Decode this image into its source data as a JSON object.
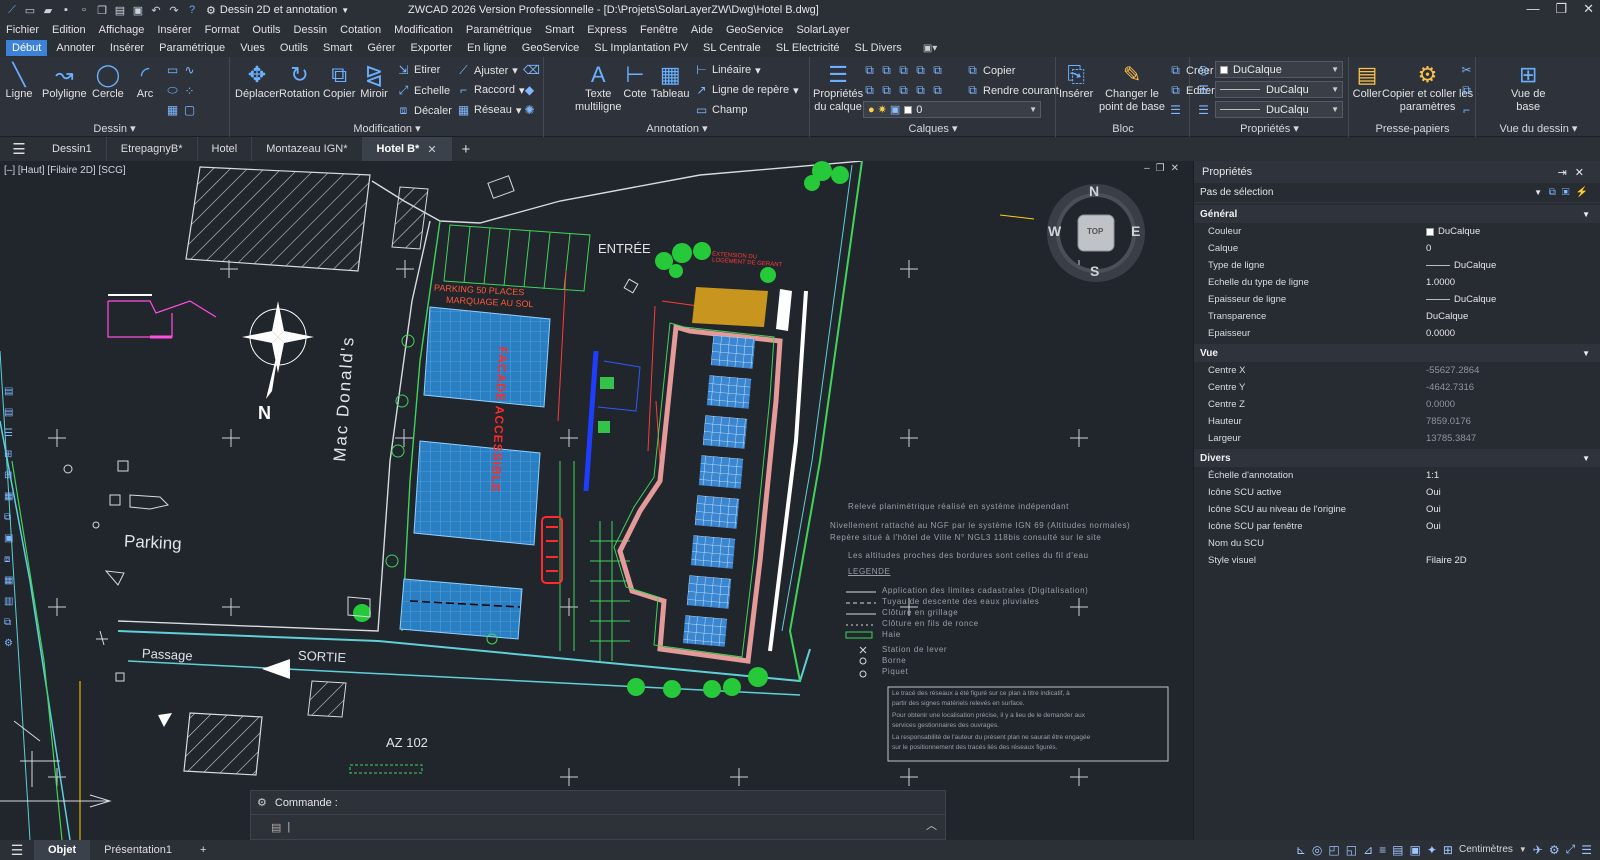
{
  "titlebar": {
    "workspace": "Dessin 2D et annotation",
    "title": "ZWCAD 2026 Version Professionnelle - [D:\\Projets\\SolarLayerZW\\Dwg\\Hotel B.dwg]"
  },
  "menu": [
    "Fichier",
    "Edition",
    "Affichage",
    "Insérer",
    "Format",
    "Outils",
    "Dessin",
    "Cotation",
    "Modification",
    "Paramétrique",
    "Smart",
    "Express",
    "Fenêtre",
    "Aide",
    "GeoService",
    "SolarLayer"
  ],
  "ribbon_tabs": [
    "Début",
    "Annoter",
    "Insérer",
    "Paramétrique",
    "Vues",
    "Outils",
    "Smart",
    "Gérer",
    "Exporter",
    "En ligne",
    "GeoService",
    "SL Implantation PV",
    "SL Centrale",
    "SL Electricité",
    "SL Divers"
  ],
  "ribbon": {
    "dessin": {
      "label": "Dessin",
      "ligne": "Ligne",
      "polyligne": "Polyligne",
      "cercle": "Cercle",
      "arc": "Arc"
    },
    "modification": {
      "label": "Modification",
      "deplacer": "Déplacer",
      "rotation": "Rotation",
      "copier": "Copier",
      "miroir": "Miroir",
      "etirer": "Etirer",
      "echelle": "Echelle",
      "decaler": "Décaler",
      "ajuster": "Ajuster",
      "raccord": "Raccord",
      "reseau": "Réseau"
    },
    "annotation": {
      "label": "Annotation",
      "texte1": "Texte",
      "texte2": "multiligne",
      "cote": "Cote",
      "tableau": "Tableau",
      "lineaire": "Linéaire",
      "ligne_repere": "Ligne de repère",
      "champ": "Champ"
    },
    "calques": {
      "label": "Calques",
      "prop1": "Propriétés",
      "prop2": "du calque",
      "copier": "Copier",
      "rendre_courant": "Rendre courant",
      "layer": "0"
    },
    "bloc": {
      "label": "Bloc",
      "inserer": "Insérer",
      "changer1": "Changer le",
      "changer2": "point de base",
      "creer": "Créer",
      "editer": "Editer"
    },
    "proprietes": {
      "label": "Propriétés",
      "couleur": "DuCalque",
      "type": "DuCalqu",
      "epaisseur": "DuCalqu"
    },
    "presse": {
      "label": "Presse-papiers",
      "coller": "Coller",
      "copier_coller1": "Copier et coller les",
      "copier_coller2": "paramètres"
    },
    "vue": {
      "label": "Vue du dessin",
      "vue1": "Vue de",
      "vue2": "base"
    }
  },
  "doc_tabs": [
    "Dessin1",
    "EtrepagnyB*",
    "Hotel",
    "Montazeau IGN*"
  ],
  "active_doc_tab": "Hotel B*",
  "viewport_label": "[–] [Haut] [Filaire 2D] [SCG]",
  "drawing": {
    "entree": "ENTRÉE",
    "parking": "PARKING 50 PLACES",
    "marquage": "MARQUAGE AU SOL",
    "facade": "FACADE ACCESSIBLE",
    "mac": "Mac Donald's",
    "parking_label": "Parking",
    "passage": "Passage",
    "sortie": "SORTIE",
    "az": "AZ 102",
    "north": "N",
    "extension1": "EXTENSION DU",
    "extension2": "LOGEMENT DE GERANT",
    "viewcube": {
      "n": "N",
      "s": "S",
      "e": "E",
      "w": "W",
      "top": "TOP"
    },
    "notes": [
      "Relevé planimétrique réalisé en système indépendant",
      "Nivellement rattaché au NGF par le système IGN 69 (Altitudes normales)",
      "Repère situé à l'hôtel de Ville N° NGL3 118bis consulté sur le site",
      "Les altitudes proches des bordures sont celles du fil d'eau"
    ],
    "legend_title": "LEGENDE",
    "legend": [
      "Application des limites cadastrales (Digitalisation)",
      "Tuyau de descente des eaux pluviales",
      "Clôture en grillage",
      "Clôture en fils de ronce",
      "Haie",
      "Station de lever",
      "Borne",
      "Piquet"
    ],
    "disclaimer": [
      "Le tracé des réseaux a été figuré sur ce plan à titre indicatif, à",
      "partir des signes matériels relevés en surface.",
      "Pour obtenir une localisation précise, il y a lieu de le demander aux",
      "services gestionnaires des ouvrages.",
      "La responsabilité de l'auteur du présent plan ne saurait être engagée",
      "sur le positionnement des tracés liés des réseaux figurés."
    ]
  },
  "command": {
    "label": "Commande :"
  },
  "properties": {
    "title": "Propriétés",
    "selection": "Pas de sélection",
    "sections": [
      {
        "name": "Général",
        "rows": [
          {
            "k": "Couleur",
            "v": "DuCalque",
            "kind": "swatch"
          },
          {
            "k": "Calque",
            "v": "0"
          },
          {
            "k": "Type de ligne",
            "v": "DuCalque",
            "kind": "line"
          },
          {
            "k": "Echelle du type de ligne",
            "v": "1.0000"
          },
          {
            "k": "Epaisseur de ligne",
            "v": "DuCalque",
            "kind": "line"
          },
          {
            "k": "Transparence",
            "v": "DuCalque"
          },
          {
            "k": "Epaisseur",
            "v": "0.0000"
          }
        ]
      },
      {
        "name": "Vue",
        "rows": [
          {
            "k": "Centre X",
            "v": "-55627.2864",
            "kind": "dim"
          },
          {
            "k": "Centre Y",
            "v": "-4642.7316",
            "kind": "dim"
          },
          {
            "k": "Centre Z",
            "v": "0.0000",
            "kind": "dim"
          },
          {
            "k": "Hauteur",
            "v": "7859.0176",
            "kind": "dim"
          },
          {
            "k": "Largeur",
            "v": "13785.3847",
            "kind": "dim"
          }
        ]
      },
      {
        "name": "Divers",
        "rows": [
          {
            "k": "Échelle d'annotation",
            "v": "1:1"
          },
          {
            "k": "Icône SCU active",
            "v": "Oui"
          },
          {
            "k": "Icône SCU au niveau de l'origine",
            "v": "Oui"
          },
          {
            "k": "Icône SCU par fenêtre",
            "v": "Oui"
          },
          {
            "k": "Nom du SCU",
            "v": ""
          },
          {
            "k": "Style visuel",
            "v": "Filaire 2D"
          }
        ]
      }
    ]
  },
  "status": {
    "tabs": [
      "Objet",
      "Présentation1"
    ],
    "units": "Centimètres"
  }
}
